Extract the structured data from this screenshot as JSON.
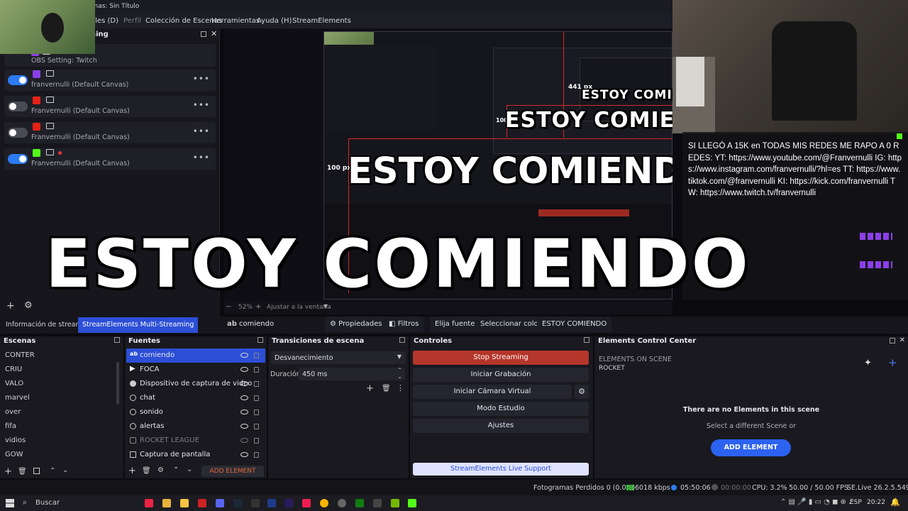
{
  "window": {
    "title": "cenas: Sin Título"
  },
  "menu": [
    "eles (D)",
    "Perfil",
    "Colección de Escenas",
    "Herramientas",
    "Ayuda (H)",
    "StreamElements"
  ],
  "multistream": {
    "header_fragment": "ning",
    "rows": [
      {
        "platform": "twitch",
        "enabled": true,
        "label": "OBS Setting: Twitch",
        "active_first": true
      },
      {
        "platform": "twitch",
        "enabled": true,
        "label": "franvernulli (Default Canvas)"
      },
      {
        "platform": "youtube",
        "enabled": false,
        "label": "Franvernulli (Default Canvas)"
      },
      {
        "platform": "youtube",
        "enabled": false,
        "label": "Franvernulli (Default Canvas)"
      },
      {
        "platform": "kick",
        "enabled": true,
        "label": "Franvernulli (Default Canvas)"
      }
    ]
  },
  "overlay": {
    "big_text": "ESTOY COMIENDO",
    "mid_text": "ESTOY COMIENDO",
    "small_text": "ESTOY COMIE",
    "measure_441": "441 px",
    "measure_100": "100 px",
    "measure_100b": "100 px"
  },
  "chat": {
    "message": "SI LLEGÓ A 15K en TODAS MIS REDES ME RAPO A 0 REDES: YT: https://www.youtube.com/@Franvernulli IG: https://www.instagram.com/franvernulli/?hl=es TT: https://www.tiktok.com/@franvernulli KI: https://kick.com/franvernulli TW: https://www.twitch.tv/franvernulli"
  },
  "zoom": {
    "level": "52%",
    "fit_label": "Ajustar a la ventana"
  },
  "tabs": {
    "info": "Información de stream",
    "multistream": "StreamElements Multi-Streaming",
    "current_source": "comiendo",
    "properties": "Propiedades",
    "filters": "Filtros",
    "choose_source": "Elija fuente",
    "select_color": "Seleccionar color",
    "text_source": "ESTOY COMIENDO"
  },
  "scenes": {
    "title": "Escenas",
    "items": [
      "CONTER",
      "CRIU",
      "VALO",
      "marvel",
      "over",
      "fifa",
      "vidios",
      "GOW"
    ]
  },
  "sources": {
    "title": "Fuentes",
    "add_element": "ADD ELEMENT",
    "items": [
      {
        "label": "comiendo",
        "icon": "text",
        "selected": true
      },
      {
        "label": "FOCA",
        "icon": "play"
      },
      {
        "label": "Dispositivo de captura de video",
        "icon": "camera"
      },
      {
        "label": "chat",
        "icon": "globe"
      },
      {
        "label": "sonido",
        "icon": "globe"
      },
      {
        "label": "alertas",
        "icon": "globe"
      },
      {
        "label": "ROCKET LEAGUE",
        "icon": "game",
        "hidden": true
      },
      {
        "label": "Captura de pantalla",
        "icon": "monitor"
      }
    ]
  },
  "transitions": {
    "title": "Transiciones de escena",
    "selected": "Desvanecimiento",
    "duration_label": "Duración",
    "duration_value": "450 ms"
  },
  "controls": {
    "title": "Controles",
    "stop_streaming": "Stop Streaming",
    "start_recording": "Iniciar Grabación",
    "virtual_cam": "Iniciar Cámara Virtual",
    "studio_mode": "Modo Estudio",
    "settings": "Ajustes",
    "live_support": "StreamElements Live Support"
  },
  "elements_center": {
    "title": "Elements Control Center",
    "on_scene": "ELEMENTS ON SCENE",
    "scene_name": "ROCKET",
    "empty_title": "There are no Elements in this scene",
    "empty_sub": "Select a different Scene or",
    "add_button": "ADD ELEMENT"
  },
  "status": {
    "dropped_frames": "Fotogramas Perdidos 0 (0.0%)",
    "bitrate": "6018 kbps",
    "live_time": "05:50:06",
    "rec_time": "00:00:00",
    "cpu": "CPU: 3.2%",
    "fps": "50.00 / 50.00 FPS",
    "version": "SE.Live 26.2.5.549"
  },
  "taskbar": {
    "search_placeholder": "Buscar",
    "lang": "ESP",
    "time": "20:22"
  },
  "colors": {
    "accent": "#2c4fd6",
    "stop_red": "#b5362a",
    "toggle_on": "#2c7bf2"
  }
}
